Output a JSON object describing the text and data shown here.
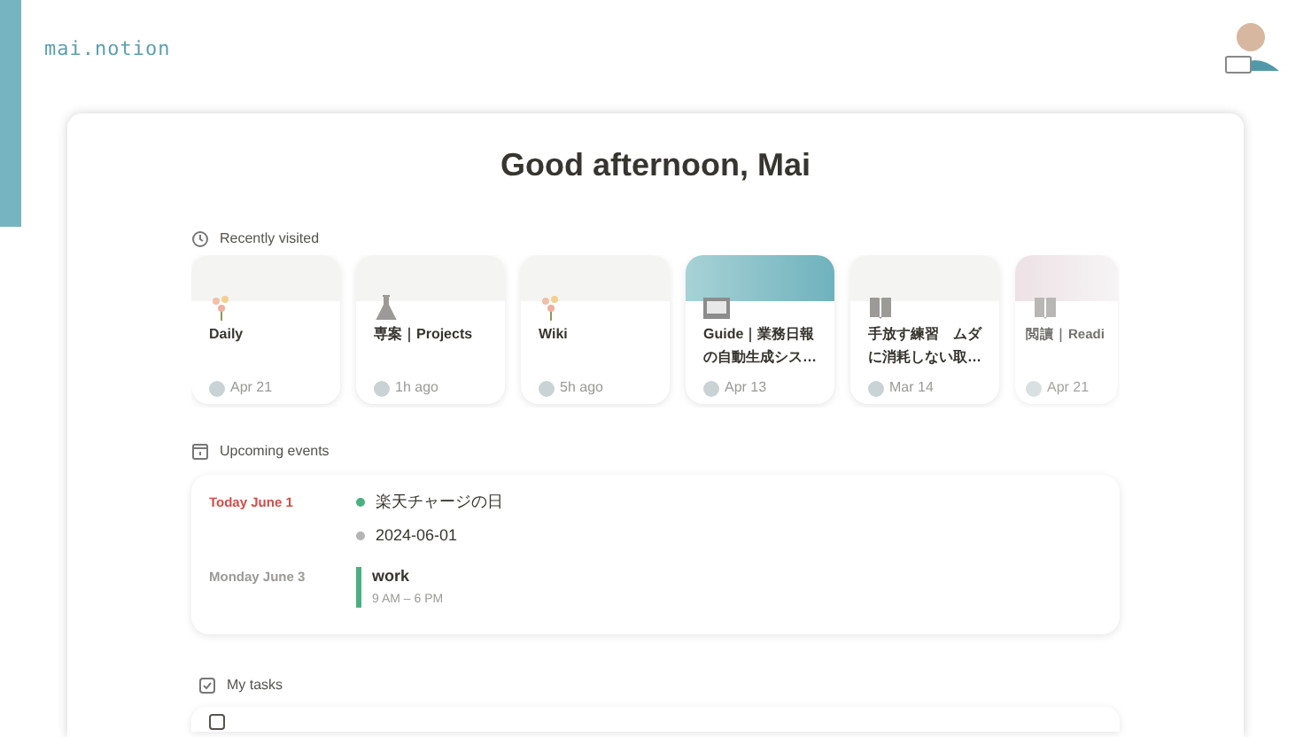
{
  "logo": "mai.notion",
  "greeting": "Good afternoon, Mai",
  "recently_visited": {
    "label": "Recently visited",
    "pages": [
      {
        "title": "Daily",
        "kind": "flower",
        "date": "Apr 21",
        "faded": false
      },
      {
        "title": "専案｜Projects",
        "kind": "flask",
        "date": "1h ago",
        "faded": false
      },
      {
        "title": "Wiki",
        "kind": "flower",
        "date": "5h ago",
        "faded": false
      },
      {
        "title": "Guide｜業務日報の自動生成シス…",
        "kind": "picture",
        "date": "Apr 13",
        "faded": false
      },
      {
        "title": "手放す練習　ムダに消耗しない取…",
        "kind": "book",
        "date": "Mar 14",
        "faded": false
      },
      {
        "title": "閲讀｜Readi",
        "kind": "book",
        "date": "Apr 21",
        "faded": true
      }
    ]
  },
  "upcoming_events": {
    "label": "Upcoming events",
    "days": [
      {
        "date": "Today June 1",
        "today": true,
        "events": [
          {
            "kind": "allday",
            "title": "楽天チャージの日",
            "color": "#4caf82"
          },
          {
            "kind": "allday",
            "title": "2024-06-01",
            "color": "#b4b4b4"
          }
        ]
      },
      {
        "date": "Monday June 3",
        "today": false,
        "events": [
          {
            "kind": "timed",
            "title": "work",
            "time": "9 AM – 6 PM",
            "color": "#4caf82"
          }
        ]
      }
    ]
  },
  "my_tasks": {
    "label": "My tasks",
    "tasks": [
      {
        "checked": false
      }
    ]
  }
}
